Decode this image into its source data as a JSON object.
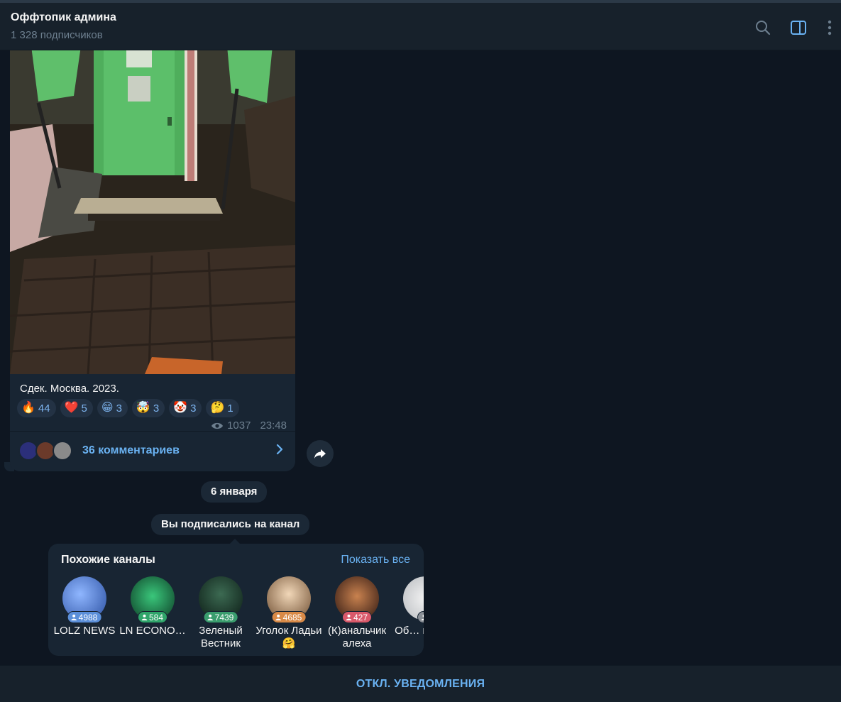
{
  "header": {
    "title": "Оффтопик админа",
    "subscribers": "1 328 подписчиков",
    "icons": [
      "search-icon",
      "sidebar-toggle-icon",
      "more-vertical-icon"
    ]
  },
  "post": {
    "caption": "Сдек. Москва. 2023.",
    "reactions": [
      {
        "emoji": "🔥",
        "count": "44"
      },
      {
        "emoji": "❤️",
        "count": "5"
      },
      {
        "emoji": "😁",
        "count": "3"
      },
      {
        "emoji": "🤯",
        "count": "3"
      },
      {
        "emoji": "🤡",
        "count": "3"
      },
      {
        "emoji": "🤔",
        "count": "1"
      }
    ],
    "views": "1037",
    "time": "23:48",
    "comments_label": "36 комментариев"
  },
  "service": {
    "date": "6 января",
    "subscribed": "Вы подписались на канал"
  },
  "similar": {
    "title": "Похожие каналы",
    "show_all": "Показать все",
    "channels": [
      {
        "name": "LOLZ NEWS",
        "count": "4988",
        "color": "#5b8fd9"
      },
      {
        "name": "LN ECONO…",
        "count": "584",
        "color": "#2fa56a"
      },
      {
        "name": "Зеленый Вестник",
        "count": "7439",
        "color": "#3a9d6e"
      },
      {
        "name": "Уголок Ладьи🤗",
        "count": "4685",
        "color": "#d98a47"
      },
      {
        "name": "(К)анальчик алеха",
        "count": "427",
        "color": "#d9596a"
      },
      {
        "name": "Об… крип…",
        "count": "",
        "color": "#8a8f96"
      }
    ]
  },
  "footer": {
    "action": "ОТКЛ. УВЕДОМЛЕНИЯ"
  },
  "colors": {
    "background": "#0e1621",
    "panel": "#17212b",
    "bubble": "#182533",
    "accent": "#6ab2f2"
  }
}
